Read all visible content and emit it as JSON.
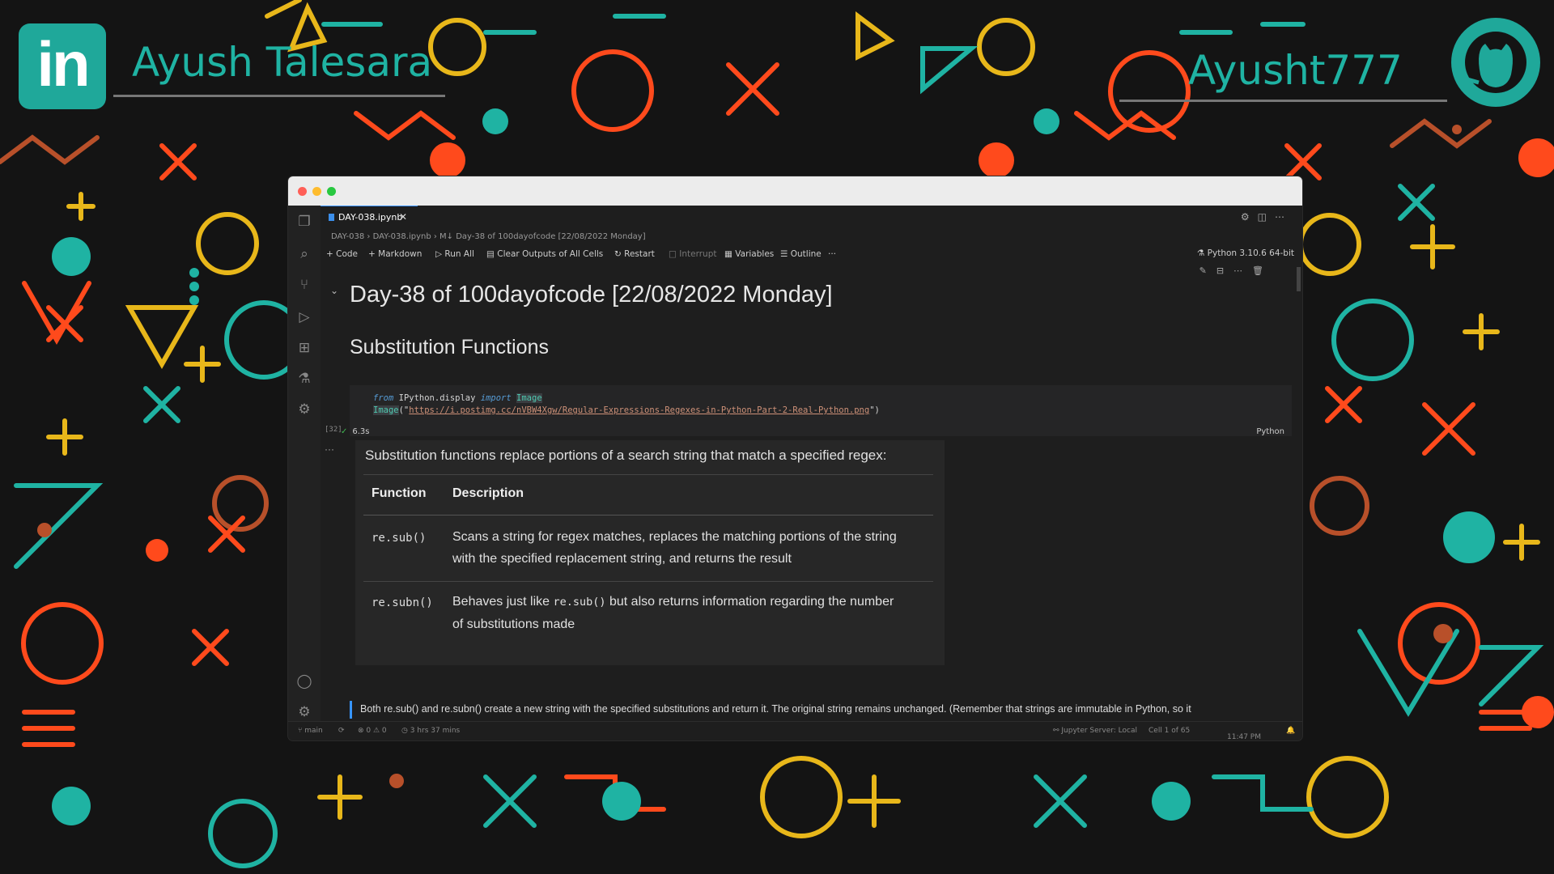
{
  "banner": {
    "linkedin_logo_text": "in",
    "left_name": "Ayush Talesara",
    "right_name": "Ayusht777",
    "github_icon": "github-icon"
  },
  "window": {
    "traffic_lights": [
      "#ff5f57",
      "#febc2e",
      "#28c840"
    ],
    "tab": {
      "label": "DAY-038.ipynb",
      "close": "✕"
    },
    "breadcrumb": "DAY-038 › DAY-038.ipynb › M↓ Day-38 of 100dayofcode [22/08/2022 Monday]",
    "toolbar": {
      "code": "Code",
      "markdown": "Markdown",
      "run_all": "Run All",
      "clear_outputs": "Clear Outputs of All Cells",
      "restart": "Restart",
      "interrupt": "Interrupt",
      "variables": "Variables",
      "outline": "Outline",
      "more": "···"
    },
    "kernel": "Python 3.10.6 64-bit"
  },
  "notebook": {
    "heading": "Day-38 of 100dayofcode [22/08/2022 Monday]",
    "subheading": "Substitution Functions",
    "code": {
      "line1_from": "from",
      "line1_module": " IPython.display ",
      "line1_import": "import",
      "line1_name": "Image",
      "line2_fn": "Image",
      "line2_open": "(\"",
      "line2_url": "https://i.postimg.cc/nVBW4Xgw/Regular-Expressions-Regexes-in-Python-Part-2-Real-Python.png",
      "line2_close": "\")",
      "exec_count": "[32]",
      "exec_time": "6.3s",
      "language": "Python"
    },
    "output": {
      "intro": "Substitution functions replace portions of a search string that match a specified regex:",
      "headers": [
        "Function",
        "Description"
      ],
      "rows": [
        {
          "fn": "re.sub()",
          "desc": "Scans a string for regex matches, replaces the matching portions of the string with the specified replacement string, and returns the result"
        },
        {
          "fn": "re.subn()",
          "desc_pre": "Behaves just like ",
          "desc_code": "re.sub()",
          "desc_post": " but also returns information regarding the number of substitutions made"
        }
      ]
    },
    "markdown_line": "Both re.sub() and re.subn() create a new string with the specified substitutions and return it. The original string remains unchanged. (Remember that strings are immutable in Python, so it"
  },
  "statusbar": {
    "branch": "main",
    "problems": "⊗ 0 ⚠ 0",
    "timer": "3 hrs 37 mins",
    "jupyter": "Jupyter Server: Local",
    "cell": "Cell 1 of 65",
    "time": "11:47 PM"
  }
}
